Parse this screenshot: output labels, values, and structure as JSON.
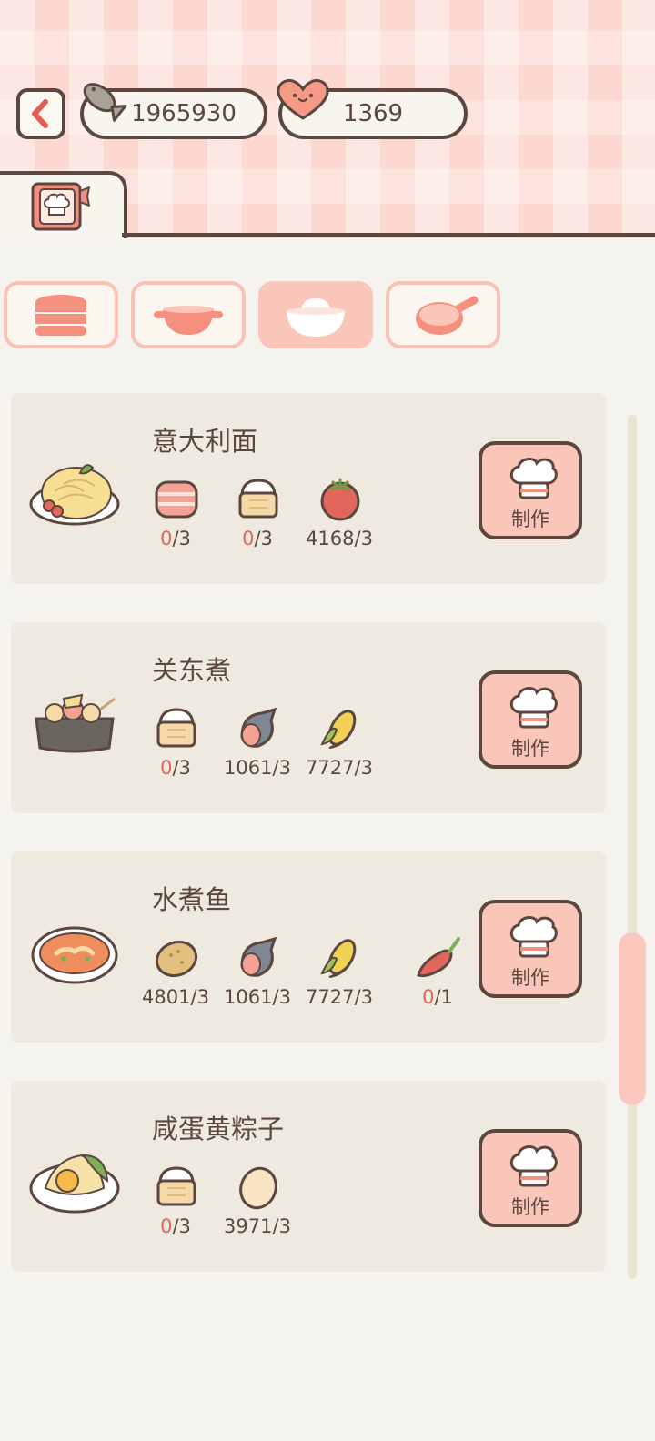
{
  "header": {
    "back_icon": "chevron-left-icon",
    "currencies": [
      {
        "icon": "fish-icon",
        "value": "1965930"
      },
      {
        "icon": "heart-icon",
        "value": "1369"
      }
    ],
    "active_tab_icon": "recipe-book-icon"
  },
  "category_tabs": [
    {
      "icon": "stacked-dishes-icon",
      "active": false
    },
    {
      "icon": "pot-icon",
      "active": false
    },
    {
      "icon": "rice-bowl-icon",
      "active": true
    },
    {
      "icon": "frying-pan-icon",
      "active": false
    }
  ],
  "recipes": [
    {
      "name": "意大利面",
      "dish_icon": "spaghetti-plate-icon",
      "ingredients": [
        {
          "icon": "bacon-icon",
          "have": "0",
          "need": "3"
        },
        {
          "icon": "flour-icon",
          "have": "0",
          "need": "3"
        },
        {
          "icon": "tomato-icon",
          "have": "4168",
          "need": "3"
        }
      ],
      "make_label": "制作"
    },
    {
      "name": "关东煮",
      "dish_icon": "oden-pot-icon",
      "ingredients": [
        {
          "icon": "flour-icon",
          "have": "0",
          "need": "3"
        },
        {
          "icon": "fish-icon",
          "have": "1061",
          "need": "3"
        },
        {
          "icon": "corn-icon",
          "have": "7727",
          "need": "3"
        }
      ],
      "make_label": "制作"
    },
    {
      "name": "水煮鱼",
      "dish_icon": "boiled-fish-bowl-icon",
      "ingredients": [
        {
          "icon": "potato-icon",
          "have": "4801",
          "need": "3"
        },
        {
          "icon": "fish-icon",
          "have": "1061",
          "need": "3"
        },
        {
          "icon": "corn-icon",
          "have": "7727",
          "need": "3"
        },
        {
          "icon": "chili-icon",
          "have": "0",
          "need": "1"
        }
      ],
      "make_label": "制作"
    },
    {
      "name": "咸蛋黄粽子",
      "dish_icon": "zongzi-plate-icon",
      "ingredients": [
        {
          "icon": "flour-icon",
          "have": "0",
          "need": "3"
        },
        {
          "icon": "egg-icon",
          "have": "3971",
          "need": "3"
        }
      ],
      "make_label": "制作"
    }
  ],
  "colors": {
    "outline": "#5b4740",
    "accent_pink": "#fbc6ba",
    "card_bg": "#efeadf",
    "page_bg": "#f5f3ee",
    "shortage_red": "#e2665b"
  }
}
